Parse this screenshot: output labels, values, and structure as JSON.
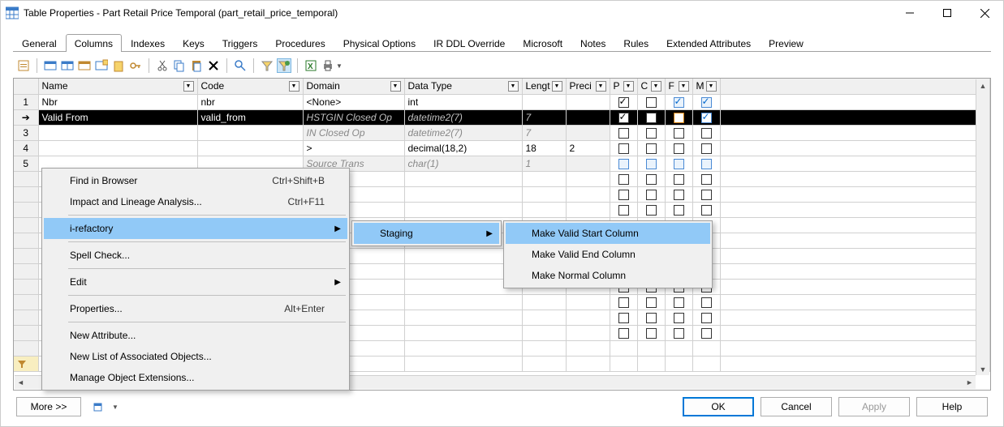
{
  "window": {
    "title": "Table Properties - Part Retail Price Temporal (part_retail_price_temporal)"
  },
  "tabs": [
    "General",
    "Columns",
    "Indexes",
    "Keys",
    "Triggers",
    "Procedures",
    "Physical Options",
    "IR DDL Override",
    "Microsoft",
    "Notes",
    "Rules",
    "Extended Attributes",
    "Preview"
  ],
  "active_tab_index": 1,
  "columns": {
    "headers": [
      "",
      "Name",
      "Code",
      "Domain",
      "Data Type",
      "Lengt",
      "Preci",
      "P",
      "C",
      "F",
      "M"
    ],
    "rows": [
      {
        "num": "1",
        "name": "Nbr",
        "code": "nbr",
        "domain": "<None>",
        "datatype": "int",
        "length": "",
        "prec": "",
        "p": true,
        "c": false,
        "f": true,
        "m": true,
        "fblue": true,
        "mblue": true
      },
      {
        "num": "",
        "selected": true,
        "name": "Valid From",
        "code": "valid_from",
        "domain": "HSTGIN Closed Op",
        "datatype": "datetime2(7)",
        "length": "7",
        "prec": "",
        "p": true,
        "c": false,
        "f": false,
        "m": true,
        "forange": true,
        "mblue": true
      },
      {
        "num": "3",
        "name": "",
        "code": "",
        "domain": "IN Closed Op",
        "datatype": "datetime2(7)",
        "length": "7",
        "prec": "",
        "p": false,
        "c": false,
        "f": false,
        "m": false,
        "grey": true
      },
      {
        "num": "4",
        "name": "",
        "code": "",
        "domain": ">",
        "datatype": "decimal(18,2)",
        "length": "18",
        "prec": "2",
        "p": false,
        "c": false,
        "f": false,
        "m": false
      },
      {
        "num": "5",
        "name": "",
        "code": "",
        "domain": "Source Trans",
        "datatype": "char(1)",
        "length": "1",
        "prec": "",
        "p": false,
        "c": false,
        "f": false,
        "m": false,
        "grey": true,
        "pblue": true,
        "cblue": true,
        "fblue": true,
        "mblue": true
      }
    ]
  },
  "context_menu": {
    "items": [
      {
        "label": "Find in Browser",
        "shortcut": "Ctrl+Shift+B"
      },
      {
        "label": "Impact and Lineage Analysis...",
        "shortcut": "Ctrl+F11"
      },
      {
        "sep": true
      },
      {
        "label": "i-refactory",
        "sub": true,
        "hi": true
      },
      {
        "sep": true
      },
      {
        "label": "Spell Check..."
      },
      {
        "sep": true
      },
      {
        "label": "Edit",
        "sub": true
      },
      {
        "sep": true
      },
      {
        "label": "Properties...",
        "shortcut": "Alt+Enter"
      },
      {
        "sep": true
      },
      {
        "label": "New Attribute..."
      },
      {
        "label": "New List of Associated Objects..."
      },
      {
        "label": "Manage Object Extensions..."
      }
    ],
    "sub1": {
      "label": "Staging",
      "hi": true
    },
    "sub2": [
      {
        "label": "Make Valid Start Column",
        "hi": true
      },
      {
        "label": "Make Valid End Column"
      },
      {
        "label": "Make Normal Column"
      }
    ]
  },
  "footer": {
    "more": "More >>",
    "ok": "OK",
    "cancel": "Cancel",
    "apply": "Apply",
    "help": "Help"
  }
}
